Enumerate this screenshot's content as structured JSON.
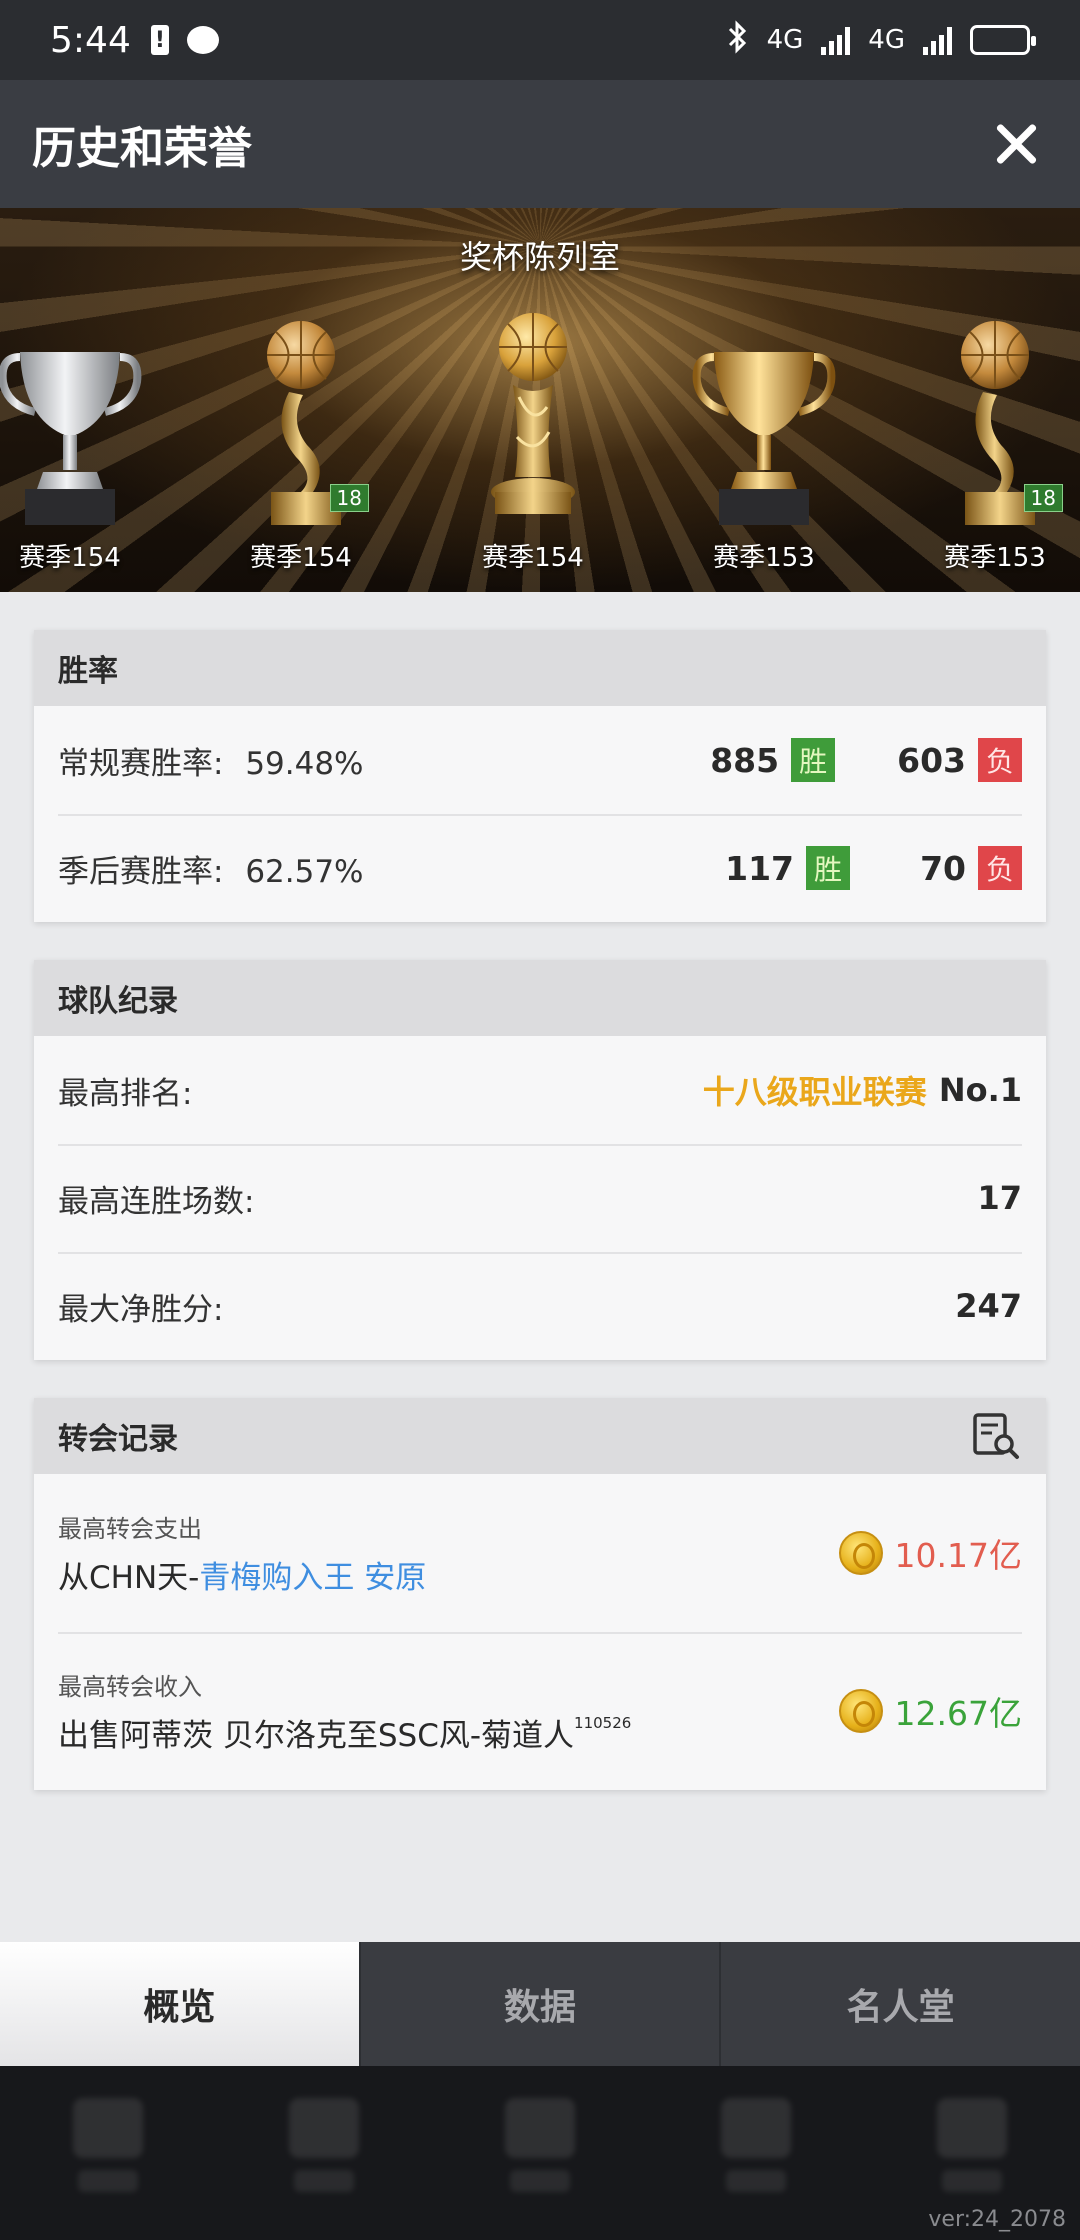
{
  "status_bar": {
    "time": "5:44",
    "network_1": "4G",
    "network_2": "4G"
  },
  "header": {
    "title": "历史和荣誉"
  },
  "trophy_room": {
    "title": "奖杯陈列室",
    "trophies": [
      {
        "season": "赛季154",
        "kind": "silver-cup",
        "badge": ""
      },
      {
        "season": "赛季154",
        "kind": "gold-ball",
        "badge": "18"
      },
      {
        "season": "赛季154",
        "kind": "gold-ball-tall",
        "badge": ""
      },
      {
        "season": "赛季153",
        "kind": "gold-cup",
        "badge": ""
      },
      {
        "season": "赛季153",
        "kind": "gold-ball",
        "badge": "18"
      }
    ]
  },
  "win_rate": {
    "title": "胜率",
    "rows": [
      {
        "label": "常规赛胜率:",
        "value": "59.48%",
        "wins": "885",
        "win_tag": "胜",
        "losses": "603",
        "loss_tag": "负"
      },
      {
        "label": "季后赛胜率:",
        "value": "62.57%",
        "wins": "117",
        "win_tag": "胜",
        "losses": "70",
        "loss_tag": "负"
      }
    ]
  },
  "team_record": {
    "title": "球队纪录",
    "rows": [
      {
        "label": "最高排名:",
        "league": "十八级职业联赛",
        "value": "No.1"
      },
      {
        "label": "最高连胜场数:",
        "value": "17"
      },
      {
        "label": "最大净胜分:",
        "value": "247"
      }
    ]
  },
  "transfer_record": {
    "title": "转会记录",
    "rows": [
      {
        "caption": "最高转会支出",
        "prefix": "从CHN天-",
        "link": "青梅购入王 安原",
        "amount": "10.17亿"
      },
      {
        "caption": "最高转会收入",
        "prefix": "出售阿蒂茨 贝尔洛克至SSC风-菊道人",
        "sup": "110526",
        "amount": "12.67亿"
      }
    ]
  },
  "tabs": [
    "概览",
    "数据",
    "名人堂"
  ],
  "active_tab": "概览",
  "version": "ver:24_2078",
  "colors": {
    "win": "#3f9c3a",
    "loss": "#e0464a",
    "league": "#eaa71b",
    "link": "#3f8ee0",
    "expense": "#e25d4f",
    "income": "#3aa33a"
  }
}
